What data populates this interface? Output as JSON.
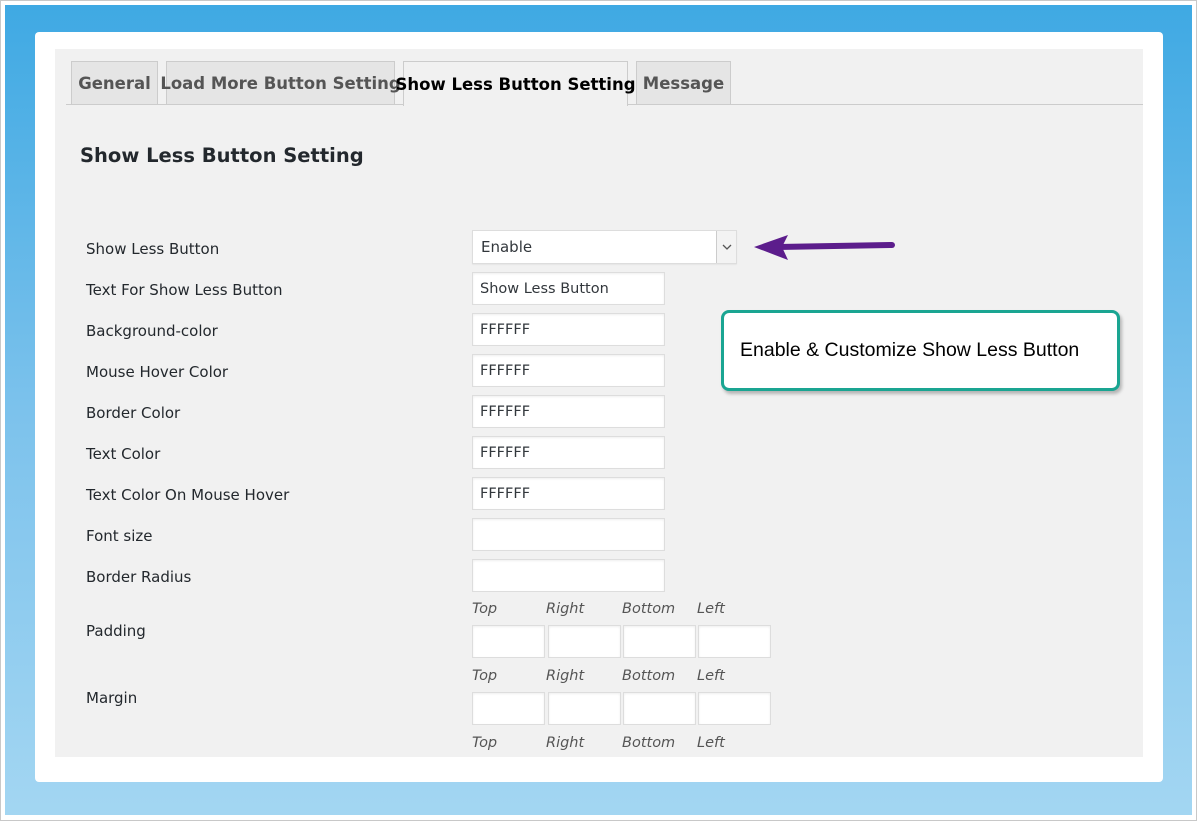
{
  "tabs": [
    {
      "label": "General",
      "active": false
    },
    {
      "label": "Load More Button Setting",
      "active": false
    },
    {
      "label": "Show Less Button Setting",
      "active": true
    },
    {
      "label": "Message",
      "active": false
    }
  ],
  "section_title": "Show Less Button Setting",
  "fields": {
    "show_less_button": {
      "label": "Show Less Button",
      "value": "Enable"
    },
    "text_for_show_less": {
      "label": "Text For Show Less Button",
      "value": "Show Less Button"
    },
    "background_color": {
      "label": "Background-color",
      "value": "FFFFFF"
    },
    "mouse_hover_color": {
      "label": "Mouse Hover Color",
      "value": "FFFFFF"
    },
    "border_color": {
      "label": "Border Color",
      "value": "FFFFFF"
    },
    "text_color": {
      "label": "Text Color",
      "value": "FFFFFF"
    },
    "text_color_hover": {
      "label": "Text Color On Mouse Hover",
      "value": "FFFFFF"
    },
    "font_size": {
      "label": "Font size",
      "value": ""
    },
    "border_radius": {
      "label": "Border Radius",
      "value": ""
    },
    "padding": {
      "label": "Padding"
    },
    "margin": {
      "label": "Margin"
    }
  },
  "sides": {
    "top": "Top",
    "right": "Right",
    "bottom": "Bottom",
    "left": "Left"
  },
  "callout": "Enable & Customize Show Less Button",
  "colors": {
    "background_gradient_top": "#3fa9e3",
    "background_gradient_bottom": "#a3d6f2",
    "callout_border": "#1aa592",
    "arrow": "#5c1d8c"
  },
  "icons": {
    "select_caret": "chevron-down-icon",
    "annotation_arrow": "arrow-left-icon"
  }
}
